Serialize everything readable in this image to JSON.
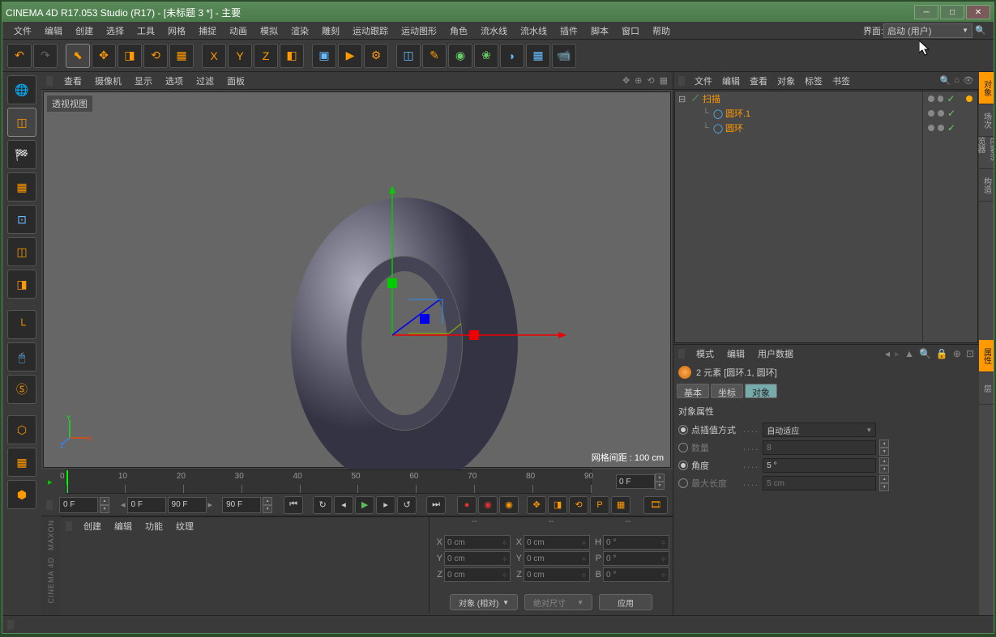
{
  "title": "CINEMA 4D R17.053 Studio (R17) - [未标题 3 *] - 主要",
  "menus": [
    "文件",
    "编辑",
    "创建",
    "选择",
    "工具",
    "网格",
    "捕捉",
    "动画",
    "模拟",
    "渲染",
    "雕刻",
    "运动跟踪",
    "运动图形",
    "角色",
    "流水线",
    "流水线",
    "插件",
    "脚本",
    "窗口",
    "帮助"
  ],
  "layout_label": "界面:",
  "layout_value": "启动 (用户)",
  "viewport_menu": [
    "查看",
    "摄像机",
    "显示",
    "选项",
    "过滤",
    "面板"
  ],
  "viewport_label": "透视视图",
  "viewport_grid": "网格间距 : 100 cm",
  "timeline": {
    "start": 0,
    "end": 90,
    "ticks": [
      0,
      10,
      20,
      30,
      40,
      50,
      60,
      70,
      80,
      90
    ],
    "current": "0 F",
    "range_a": "0 F",
    "range_b": "90 F",
    "range_c": "90 F",
    "field_right": "0 F"
  },
  "mat_menu": [
    "创建",
    "编辑",
    "功能",
    "纹理"
  ],
  "coord": {
    "headers": [
      "--",
      "--",
      "--"
    ],
    "rows": [
      {
        "lbl": "X",
        "a": "0 cm",
        "lbl2": "X",
        "b": "0 cm",
        "lbl3": "H",
        "c": "0 °"
      },
      {
        "lbl": "Y",
        "a": "0 cm",
        "lbl2": "Y",
        "b": "0 cm",
        "lbl3": "P",
        "c": "0 °"
      },
      {
        "lbl": "Z",
        "a": "0 cm",
        "lbl2": "Z",
        "b": "0 cm",
        "lbl3": "B",
        "c": "0 °"
      }
    ],
    "mode": "对象 (相对)",
    "size_mode": "绝对尺寸",
    "apply": "应用"
  },
  "obj_menu": [
    "文件",
    "编辑",
    "查看",
    "对象",
    "标签",
    "书签"
  ],
  "tree": [
    {
      "name": "扫描",
      "indent": 0,
      "toggle": "⊟",
      "color": "orange",
      "icon": "sweep"
    },
    {
      "name": "圆环.1",
      "indent": 1,
      "toggle": "",
      "color": "orange",
      "icon": "circle"
    },
    {
      "name": "圆环",
      "indent": 1,
      "toggle": "",
      "color": "orange",
      "icon": "circle"
    }
  ],
  "attr_menu": [
    "模式",
    "编辑",
    "用户数据"
  ],
  "attr_title": "2 元素 [圆环.1, 圆环]",
  "attr_tabs": [
    "基本",
    "坐标",
    "对象"
  ],
  "attr_section": "对象属性",
  "attr_rows": [
    {
      "radio": true,
      "label": "点插值方式",
      "field": "自动适应",
      "type": "dropdown",
      "dim": false
    },
    {
      "radio": false,
      "label": "数量",
      "field": "8",
      "type": "num",
      "dim": true
    },
    {
      "radio": true,
      "label": "角度",
      "field": "5 °",
      "type": "num",
      "dim": false
    },
    {
      "radio": false,
      "label": "最大长度",
      "field": "5 cm",
      "type": "num",
      "dim": true
    }
  ],
  "side_tabs": [
    "对象",
    "场次",
    "内容浏览器",
    "构造"
  ],
  "side_tabs2": [
    "属性",
    "层"
  ],
  "maxon": [
    "MAXON",
    "CINEMA 4D"
  ]
}
